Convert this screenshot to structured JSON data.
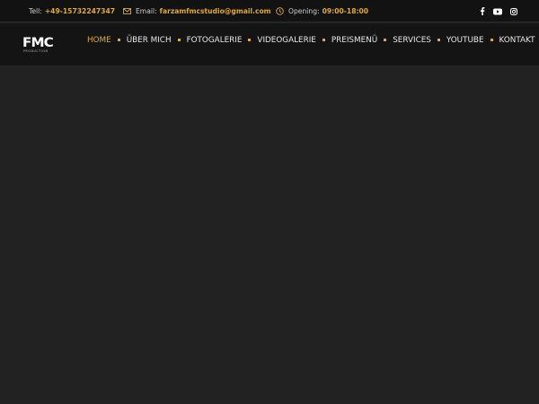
{
  "topbar": {
    "phone": {
      "label": "Tell:",
      "value": "+49-15732247347"
    },
    "email": {
      "label": "Email:",
      "value": "farzamfmcstudio@gmail.com",
      "icon": "envelope-icon"
    },
    "opening": {
      "label": "Opening:",
      "value": "09:00-18:00",
      "icon": "clock-icon"
    },
    "social": [
      "facebook-icon",
      "youtube-icon",
      "instagram-icon"
    ]
  },
  "logo": {
    "mark": "FMC",
    "sub": "PRODUCTION"
  },
  "nav": {
    "items": [
      {
        "label": "HOME",
        "active": true
      },
      {
        "label": "ÜBER MICH"
      },
      {
        "label": "FOTOGALERIE"
      },
      {
        "label": "VIDEOGALERIE"
      },
      {
        "label": "PREISMENÜ"
      },
      {
        "label": "SERVICES"
      },
      {
        "label": "YOUTUBE"
      },
      {
        "label": "KONTAKT"
      }
    ]
  },
  "colors": {
    "accent": "#e0a93a",
    "topbar_bg": "#121212",
    "header_bg": "#141414",
    "page_bg": "#222222"
  }
}
